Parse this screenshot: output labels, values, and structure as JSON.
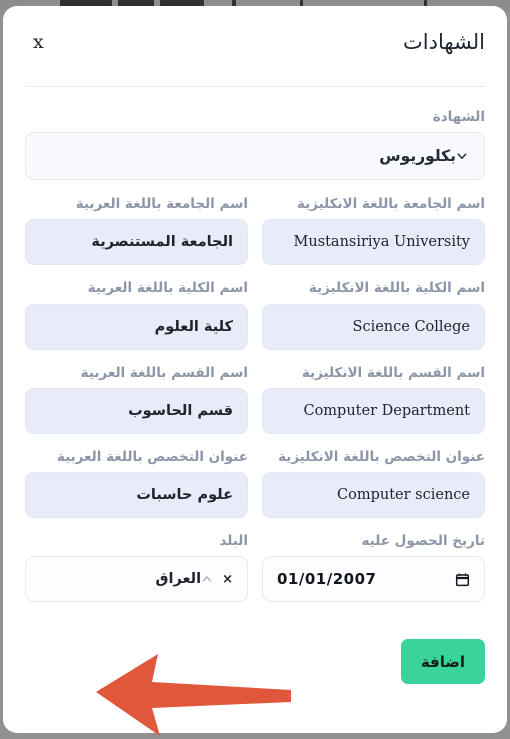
{
  "window": {
    "backdrop_color": "#8e8e8e",
    "modal_background": "#ffffff"
  },
  "header": {
    "title": "الشهادات",
    "close_label": "x"
  },
  "form": {
    "degree": {
      "label": "الشهادة",
      "value": "بكلوريوس",
      "caret_icon": "chevron-down-icon"
    },
    "rows": [
      {
        "arabic": {
          "label": "اسم الجامعة باللغة العربية",
          "value": "الجامعة المستنصرية",
          "placeholder": ""
        },
        "english": {
          "label": "اسم الجامعة باللغة الانكليزية",
          "value": "Mustansiriya University",
          "placeholder": ""
        },
        "name_ar": "university-name-arabic",
        "name_en": "university-name-english"
      },
      {
        "arabic": {
          "label": "اسم الكلية باللغة العربية",
          "value": "كلية العلوم",
          "placeholder": ""
        },
        "english": {
          "label": "اسم الكلية باللغة الانكليزية",
          "value": "Science College",
          "placeholder": ""
        },
        "name_ar": "college-name-arabic",
        "name_en": "college-name-english"
      },
      {
        "arabic": {
          "label": "اسم القسم باللغة العربية",
          "value": "قسم الحاسوب",
          "placeholder": ""
        },
        "english": {
          "label": "اسم القسم باللغة الانكليزية",
          "value": "Computer Department",
          "placeholder": ""
        },
        "name_ar": "department-name-arabic",
        "name_en": "department-name-english"
      },
      {
        "arabic": {
          "label": "عنوان التخصص باللغة العربية",
          "value": "علوم حاسبات",
          "placeholder": ""
        },
        "english": {
          "label": "عنوان التخصص باللغة الانكليزية",
          "value": "Computer science",
          "placeholder": ""
        },
        "name_ar": "specialization-title-arabic",
        "name_en": "specialization-title-english"
      }
    ],
    "country": {
      "label": "البلد",
      "value": "العراق",
      "clear_label": "×",
      "caret_icon": "chevron-up-icon"
    },
    "date": {
      "label": "تاريخ الحصول عليه",
      "value": "01/01/2007",
      "icon": "calendar-icon"
    }
  },
  "footer": {
    "submit_label": "اضافة",
    "submit_color": "#3bd39c"
  },
  "annotation": {
    "arrow_color": "#e0573b",
    "arrow_direction": "left"
  }
}
